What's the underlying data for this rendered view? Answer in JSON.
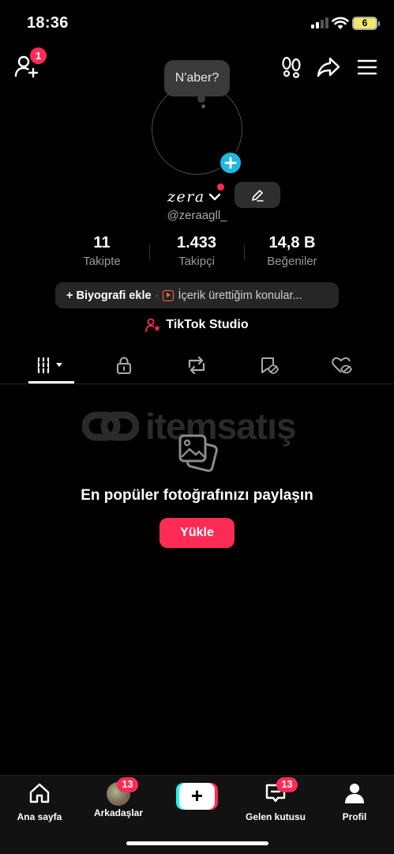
{
  "status_bar": {
    "time": "18:36",
    "battery": "6"
  },
  "header": {
    "add_friend_badge": "1",
    "icons": [
      "add-friend-icon",
      "footprints-icon",
      "share-icon",
      "menu-icon"
    ]
  },
  "profile": {
    "bubble_text": "N'aber?",
    "display_name": "zera",
    "username": "@zeraagll_",
    "stats": [
      {
        "value": "11",
        "label": "Takipte"
      },
      {
        "value": "1.433",
        "label": "Takipçi"
      },
      {
        "value": "14,8 B",
        "label": "Beğeniler"
      }
    ],
    "bio_add_label": "+ Biyografi ekle",
    "bio_separator": "·",
    "bio_topics": "İçerik ürettiğim konular...",
    "studio_label": "TikTok Studio"
  },
  "tabs": [
    "videos-grid",
    "private",
    "reposts",
    "favorites",
    "liked"
  ],
  "watermark": {
    "text": "itemsatış"
  },
  "empty_state": {
    "title": "En popüler fotoğrafınızı paylaşın",
    "button": "Yükle"
  },
  "bottom_nav": {
    "items": [
      {
        "label": "Ana sayfa"
      },
      {
        "label": "Arkadaşlar",
        "badge": "13"
      },
      {
        "label": "Gelen kutusu",
        "badge": "13"
      },
      {
        "label": "Profil"
      }
    ]
  },
  "colors": {
    "accent": "#fe2c55",
    "cyan": "#25f4ee",
    "add_avatar": "#20b8e0",
    "background": "#000000"
  }
}
